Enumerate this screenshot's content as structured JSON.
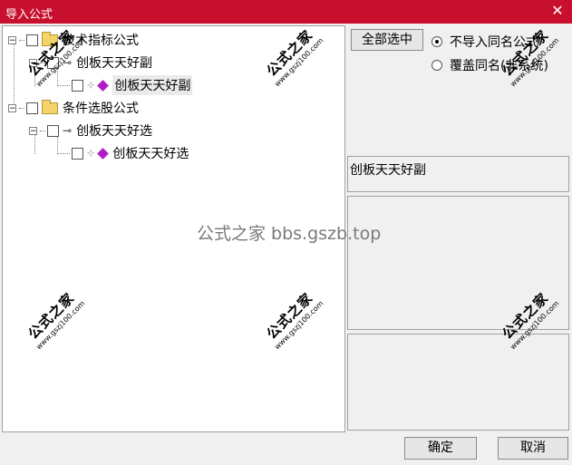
{
  "window": {
    "title": "导入公式",
    "close_glyph": "✕"
  },
  "tree": {
    "nodes": [
      {
        "label": "技术指标公式"
      },
      {
        "label": "创板天天好副"
      },
      {
        "label": "创板天天好副"
      },
      {
        "label": "条件选股公式"
      },
      {
        "label": "创板天天好选"
      },
      {
        "label": "创板天天好选"
      }
    ]
  },
  "right_panel": {
    "select_all_label": "全部选中",
    "radio_options": [
      {
        "label": "不导入同名公式",
        "checked": true
      },
      {
        "label": "覆盖同名(非系统)",
        "checked": false
      }
    ],
    "formula_name": "创板天天好副"
  },
  "footer": {
    "ok_label": "确定",
    "cancel_label": "取消"
  },
  "watermark": {
    "center_text": "公式之家 bbs.gszb.top",
    "stamp_main": "公式之家",
    "stamp_sub": "www.gszj100.com"
  }
}
